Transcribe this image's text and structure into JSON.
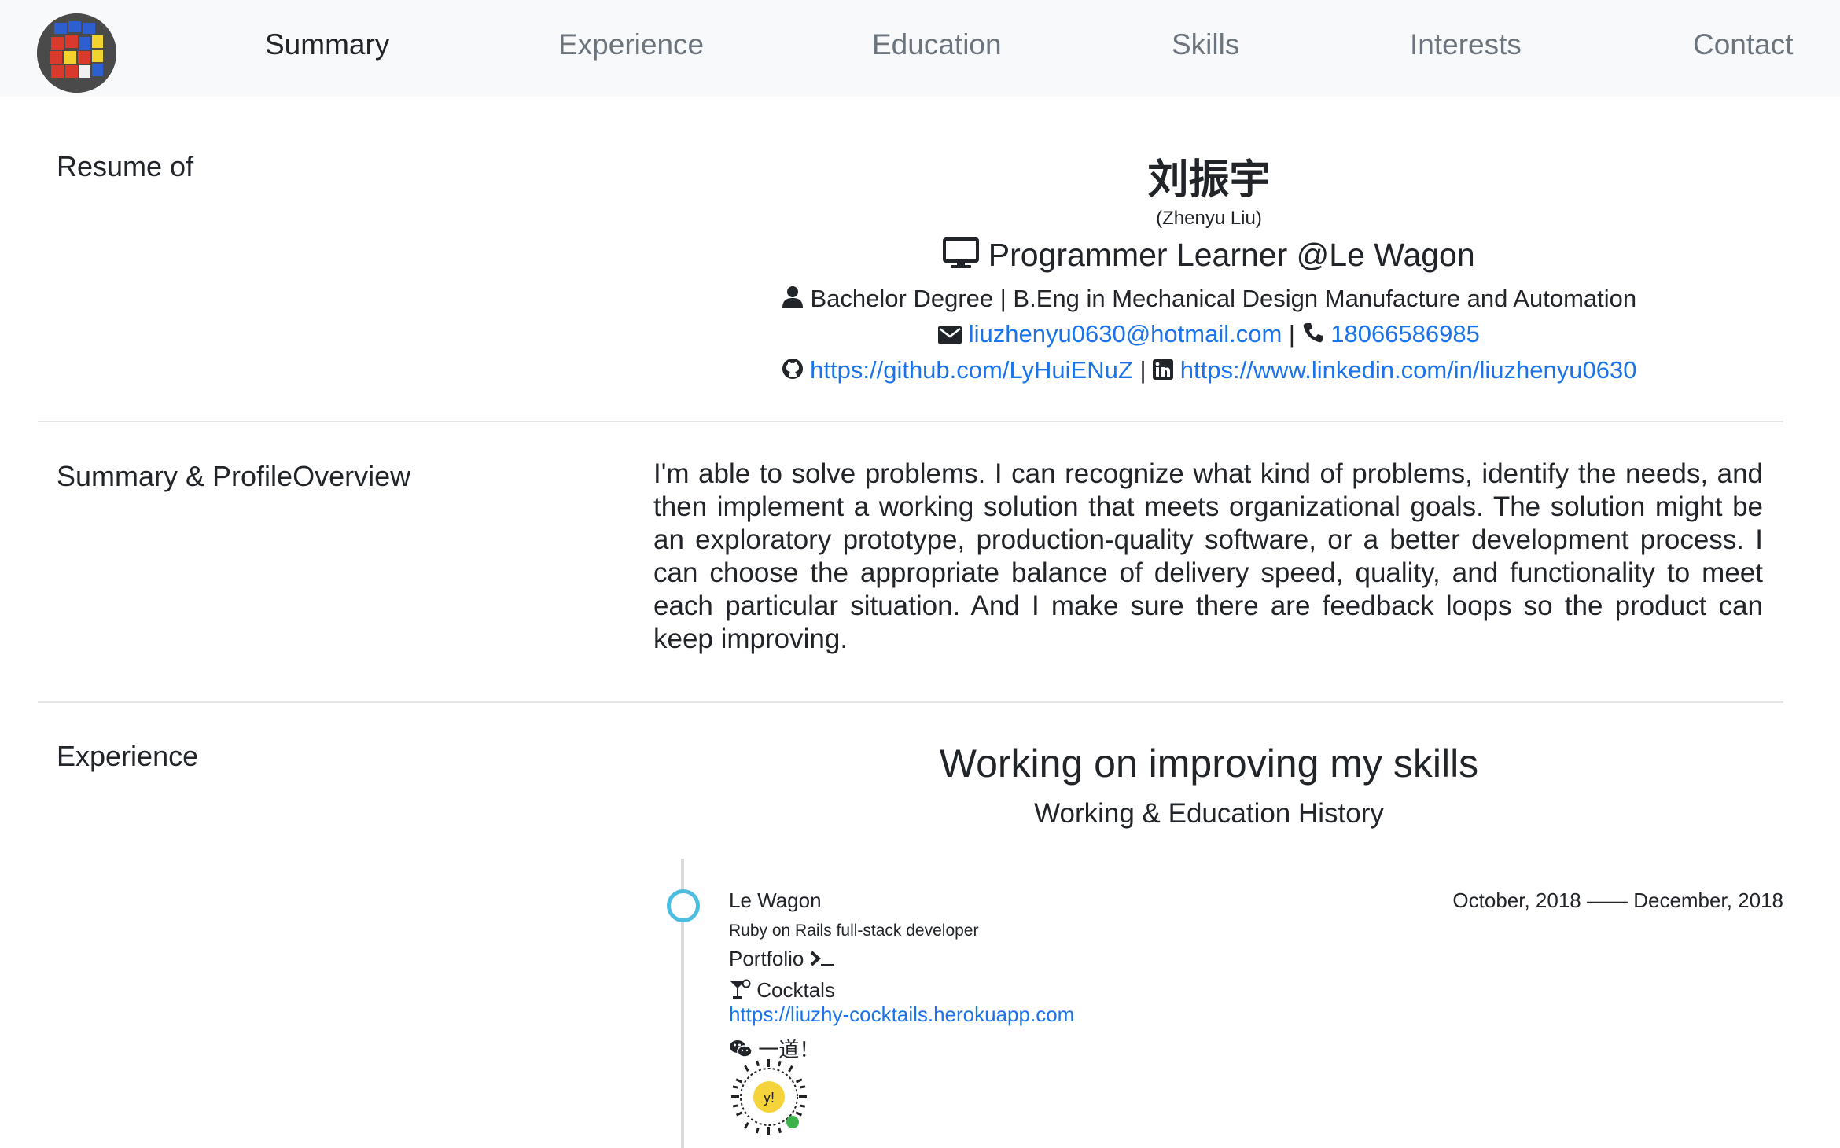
{
  "nav": {
    "items": [
      {
        "label": "Summary",
        "active": true
      },
      {
        "label": "Experience",
        "active": false
      },
      {
        "label": "Education",
        "active": false
      },
      {
        "label": "Skills",
        "active": false
      },
      {
        "label": "Interests",
        "active": false
      },
      {
        "label": "Contact",
        "active": false
      }
    ]
  },
  "resume": {
    "label": "Resume of",
    "name": "刘振宇",
    "alias": "(Zhenyu Liu)",
    "job_title": "Programmer Learner @Le Wagon",
    "degree": "Bachelor Degree | B.Eng in Mechanical Design Manufacture and Automation",
    "email": "liuzhenyu0630@hotmail.com",
    "separator": "|",
    "phone": "18066586985",
    "github": "https://github.com/LyHuiENuZ",
    "linkedin": "https://www.linkedin.com/in/liuzhenyu0630"
  },
  "summary": {
    "label": "Summary & ProfileOverview",
    "text": "I'm able to solve problems. I can recognize what kind of problems, identify the needs, and then implement a working solution that meets organizational goals. The solution might be an exploratory prototype, production-quality software, or a better development process. I can choose the appropriate balance of delivery speed, quality, and functionality to meet each particular situation. And I make sure there are feedback loops so the product can keep improving."
  },
  "experience": {
    "label": "Experience",
    "title": "Working on improving my skills",
    "subtitle": "Working & Education History",
    "entries": [
      {
        "org": "Le Wagon",
        "dates": "October, 2018 —— December, 2018",
        "role": "Ruby on Rails full-stack developer",
        "portfolio_label": "Portfolio",
        "cocktails_label": "Cocktals",
        "cocktails_url": "https://liuzhy-cocktails.herokuapp.com",
        "wechat_label": "一道！",
        "qr_logo": "y!"
      }
    ]
  },
  "colors": {
    "link": "#1a73e8",
    "nav_bg": "#f8f9fa",
    "timeline_dot": "#4fbde0",
    "text": "#212529",
    "muted": "#6c757d"
  },
  "icons": [
    "desktop-icon",
    "user-icon",
    "envelope-icon",
    "phone-icon",
    "github-icon",
    "linkedin-icon",
    "terminal-icon",
    "cocktail-icon",
    "wechat-icon"
  ]
}
